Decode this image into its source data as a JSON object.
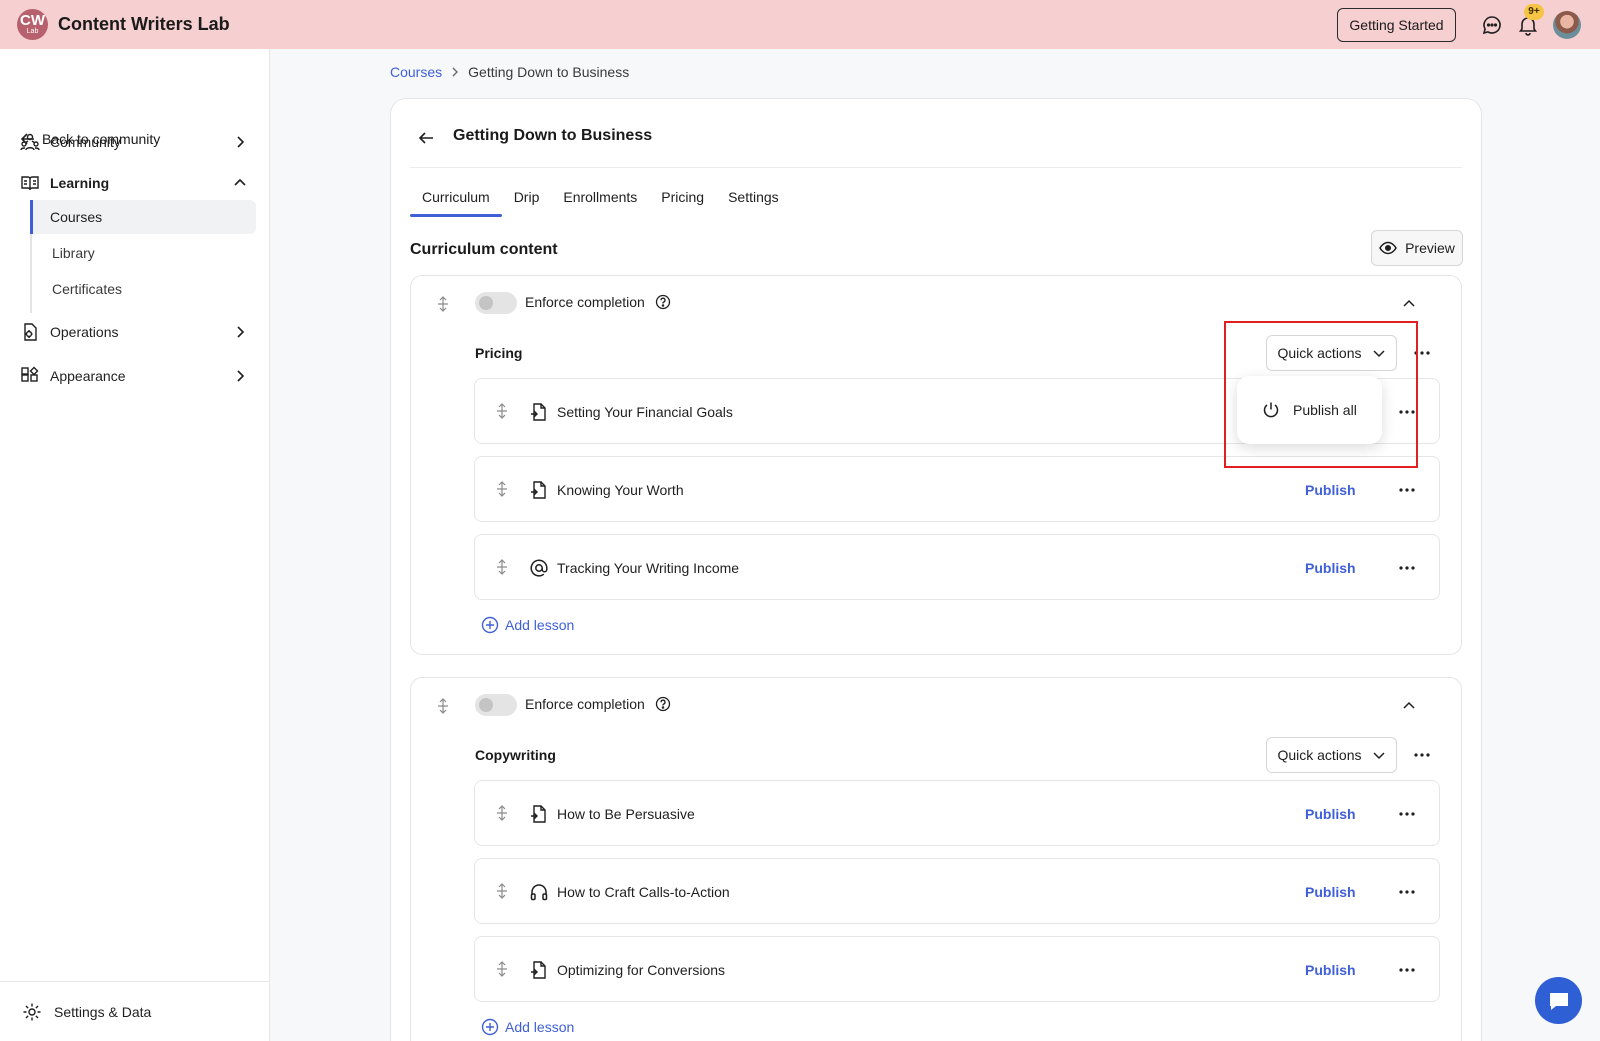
{
  "header": {
    "logo_text": "CW",
    "logo_sub": "Lab",
    "app_title": "Content Writers Lab",
    "getting_started_label": "Getting Started",
    "notification_badge": "9+",
    "colors": {
      "bar": "#f6cfd1",
      "logo": "#b8616e",
      "badge": "#f6c445"
    }
  },
  "sidebar": {
    "back_label": "Back to community",
    "items": [
      {
        "label": "Community",
        "icon": "community-icon",
        "expanded": false
      },
      {
        "label": "Learning",
        "icon": "book-icon",
        "expanded": true
      },
      {
        "label": "Operations",
        "icon": "operations-icon",
        "expanded": false
      },
      {
        "label": "Appearance",
        "icon": "appearance-icon",
        "expanded": false
      }
    ],
    "learning_subitems": [
      {
        "label": "Courses",
        "active": true
      },
      {
        "label": "Library",
        "active": false
      },
      {
        "label": "Certificates",
        "active": false
      }
    ],
    "settings_label": "Settings & Data"
  },
  "breadcrumb": {
    "root": "Courses",
    "current": "Getting Down to Business"
  },
  "course": {
    "title": "Getting Down to Business",
    "tabs": [
      "Curriculum",
      "Drip",
      "Enrollments",
      "Pricing",
      "Settings"
    ],
    "active_tab": "Curriculum",
    "section_heading": "Curriculum content",
    "preview_label": "Preview"
  },
  "modules": [
    {
      "enforce_label": "Enforce completion",
      "title": "Pricing",
      "quick_actions_label": "Quick actions",
      "lessons": [
        {
          "name": "Setting Your Financial Goals",
          "type_icon": "document-icon",
          "publish_label": ""
        },
        {
          "name": "Knowing Your Worth",
          "type_icon": "document-icon",
          "publish_label": "Publish"
        },
        {
          "name": "Tracking Your Writing Income",
          "type_icon": "at-sign-icon",
          "publish_label": "Publish"
        }
      ],
      "add_lesson_label": "Add lesson"
    },
    {
      "enforce_label": "Enforce completion",
      "title": "Copywriting",
      "quick_actions_label": "Quick actions",
      "lessons": [
        {
          "name": "How to Be Persuasive",
          "type_icon": "document-icon",
          "publish_label": "Publish"
        },
        {
          "name": "How to Craft Calls-to-Action",
          "type_icon": "headphones-icon",
          "publish_label": "Publish"
        },
        {
          "name": "Optimizing for Conversions",
          "type_icon": "document-icon",
          "publish_label": "Publish"
        }
      ],
      "add_lesson_label": "Add lesson"
    }
  ],
  "dropdown": {
    "item_label": "Publish all",
    "item_icon": "power-icon"
  },
  "colors": {
    "accent": "#3f5fd8",
    "highlight": "#e02020",
    "chat_fab": "#2f5fd4"
  }
}
